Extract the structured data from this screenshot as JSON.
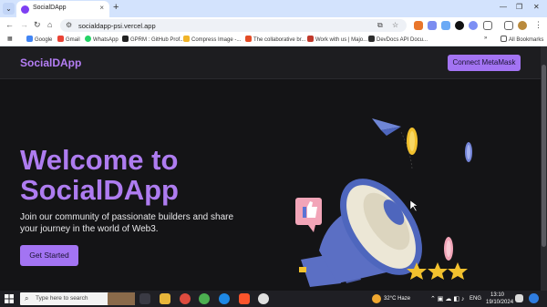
{
  "browser": {
    "tab_title": "SocialDApp",
    "url": "socialdapp-psi.vercel.app",
    "bookmarks": [
      "Google",
      "Gmail",
      "WhatsApp",
      "GPRM : GitHub Prof...",
      "Compress Image -...",
      "The collaborative br...",
      "Work with us | Majo...",
      "DevDocs API Docu..."
    ],
    "all_bookmarks": "All Bookmarks"
  },
  "navbar": {
    "brand": "SocialDApp",
    "connect_label": "Connect MetaMask"
  },
  "hero": {
    "title": "Welcome to SocialDApp",
    "subtitle": "Join our community of passionate builders and share your journey in the world of Web3.",
    "cta_label": "Get Started"
  },
  "taskbar": {
    "search_placeholder": "Type here to search",
    "weather": "32°C  Haze",
    "language": "ENG",
    "time": "13:10",
    "date": "19/10/2024"
  },
  "colors": {
    "accent": "#a374f3",
    "title": "#ae7cf0",
    "background": "#141416"
  }
}
